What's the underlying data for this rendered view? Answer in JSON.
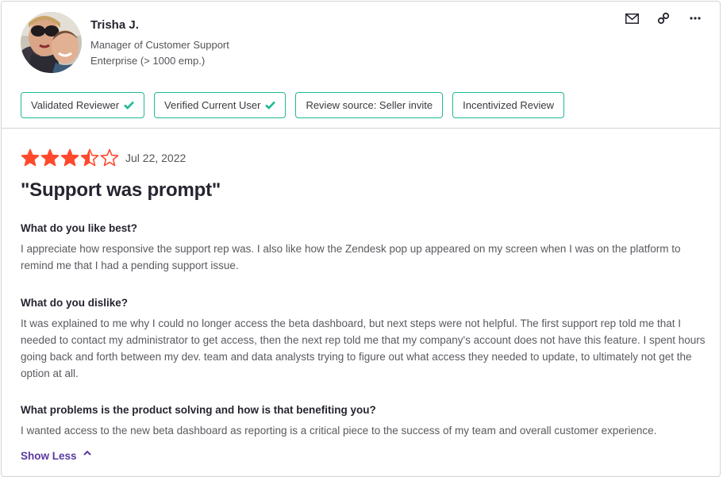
{
  "reviewer": {
    "name": "Trisha J.",
    "title": "Manager of Customer Support",
    "company_size": "Enterprise (> 1000 emp.)",
    "avatar_icon": "profile-photo"
  },
  "header_actions": [
    {
      "icon": "mail-icon",
      "label": "Email"
    },
    {
      "icon": "link-icon",
      "label": "Copy link"
    },
    {
      "icon": "more-icon",
      "label": "More options"
    }
  ],
  "badges": [
    {
      "label": "Validated Reviewer",
      "checked": true
    },
    {
      "label": "Verified Current User",
      "checked": true
    },
    {
      "label": "Review source: Seller invite",
      "checked": false
    },
    {
      "label": "Incentivized Review",
      "checked": false
    }
  ],
  "review": {
    "rating": 3.5,
    "max_rating": 5,
    "date": "Jul 22, 2022",
    "title": "\"Support was prompt\"",
    "qa": [
      {
        "question": "What do you like best?",
        "answer": "I appreciate how responsive the support rep was. I also like how the Zendesk pop up appeared on my screen when I was on the platform to remind me that I had a pending support issue."
      },
      {
        "question": "What do you dislike?",
        "answer": "It was explained to me why I could no longer access the beta dashboard, but next steps were not helpful. The first support rep told me that I needed to contact my administrator to get access, then the next rep told me that my company's account does not have this feature. I spent hours going back and forth between my dev. team and data analysts trying to figure out what access they needed to update, to ultimately not get the option at all."
      },
      {
        "question": "What problems is the product solving and how is that benefiting you?",
        "answer": "I wanted access to the new beta dashboard as reporting is a critical piece to the success of my team and overall customer experience."
      }
    ],
    "show_less_label": "Show Less"
  },
  "colors": {
    "star": "#ff492c",
    "badge_border": "#1fb995",
    "check": "#1fb995",
    "link": "#5a39a2"
  }
}
